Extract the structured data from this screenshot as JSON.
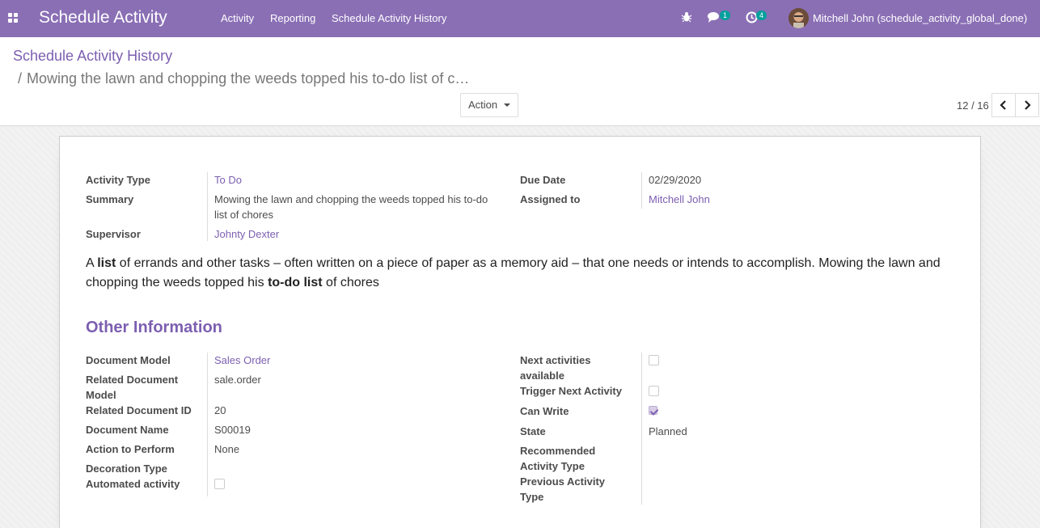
{
  "navbar": {
    "app_title": "Schedule Activity",
    "menus": [
      "Activity",
      "Reporting",
      "Schedule Activity History"
    ],
    "messages_count": "1",
    "activities_count": "4",
    "user_name": "Mitchell John (schedule_activity_global_done)",
    "color": "#8a6fb5"
  },
  "control_panel": {
    "breadcrumb_root": "Schedule Activity History",
    "breadcrumb_separator": "/",
    "breadcrumb_current": "Mowing the lawn and chopping the weeds topped his to-do list of c…",
    "action_label": "Action",
    "pager_value": "12 / 16"
  },
  "form": {
    "activity_type_label": "Activity Type",
    "activity_type": "To Do",
    "summary_label": "Summary",
    "summary_line1": "Mowing the lawn and chopping the weeds topped his to-do",
    "summary_line2": "list of chores",
    "supervisor_label": "Supervisor",
    "supervisor": "Johnty Dexter",
    "due_date_label": "Due Date",
    "due_date": "02/29/2020",
    "assigned_to_label": "Assigned to",
    "assigned_to": "Mitchell John",
    "note": {
      "p1": "A ",
      "b1": "list",
      "p2": " of errands and other tasks – often written on a piece of paper as a memory aid – that one needs or intends to accomplish. Mowing the lawn and chopping the weeds topped his ",
      "b2": "to-do list",
      "p3": " of chores"
    },
    "other_info_title": "Other Information",
    "document_model_label": "Document Model",
    "document_model": "Sales Order",
    "related_model_label_1": "Related Document",
    "related_model_label_2": "Model",
    "related_model": "sale.order",
    "related_id_label": "Related Document ID",
    "related_id": "20",
    "document_name_label": "Document Name",
    "document_name": "S00019",
    "action_to_perform_label": "Action to Perform",
    "action_to_perform": "None",
    "decoration_type_label": "Decoration Type",
    "automated_label": "Automated activity",
    "automated": false,
    "next_activities_label_1": "Next activities",
    "next_activities_label_2": "available",
    "next_activities": false,
    "trigger_next_label": "Trigger Next Activity",
    "trigger_next": false,
    "can_write_label": "Can Write",
    "can_write": true,
    "state_label": "State",
    "state": "Planned",
    "recommended_label_1": "Recommended",
    "recommended_label_2": "Activity Type",
    "previous_label_1": "Previous Activity",
    "previous_label_2": "Type"
  }
}
